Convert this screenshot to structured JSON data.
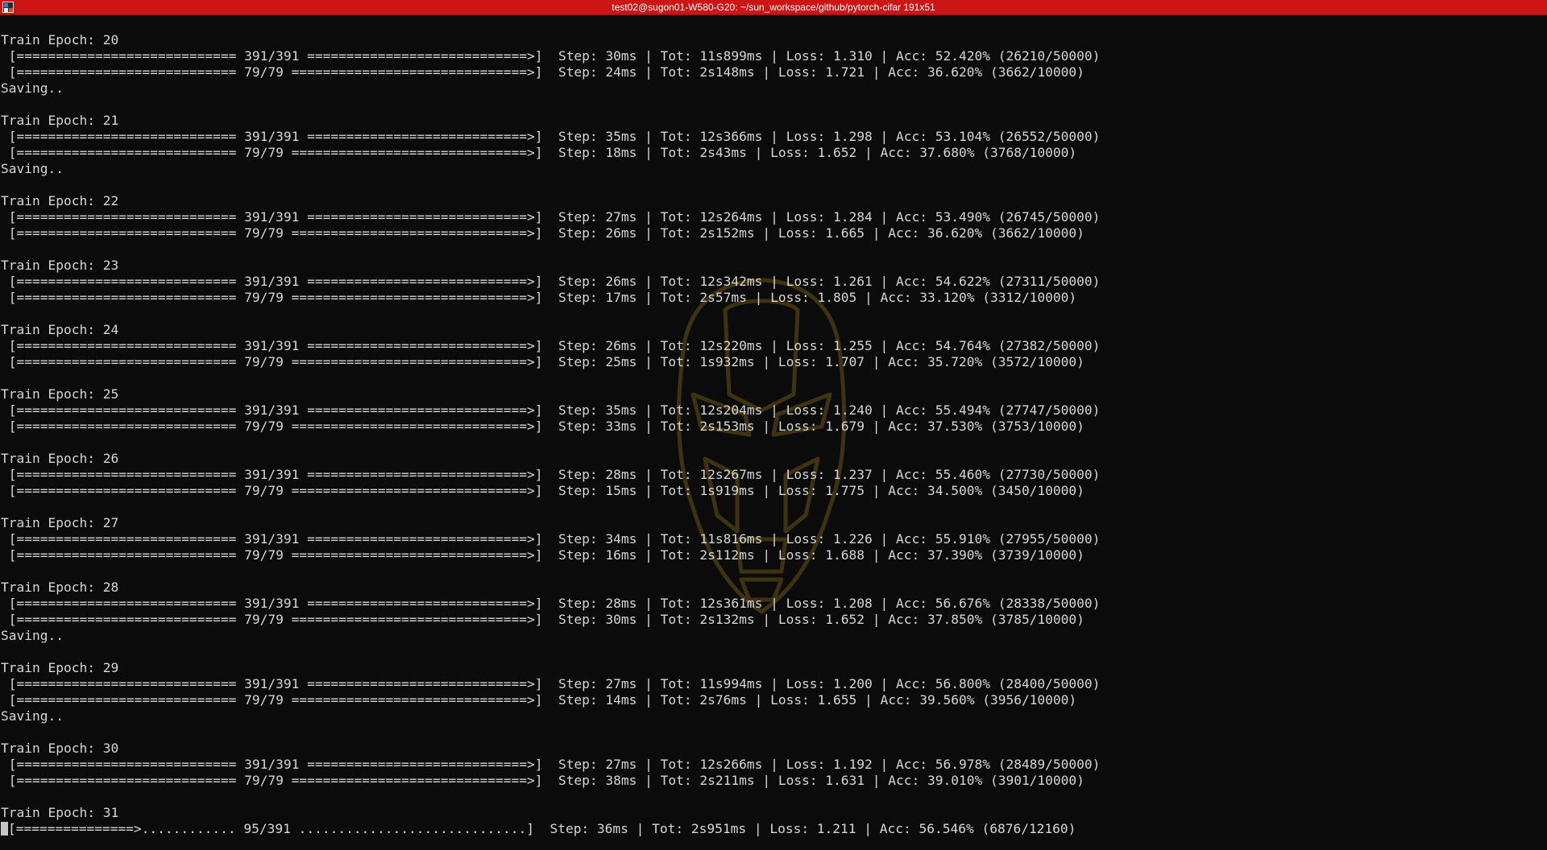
{
  "window": {
    "title": "test02@sugon01-W580-G20: ~/sun_workspace/github/pytorch-cifar 191x51"
  },
  "icons": {
    "app": "terminal-app-icon",
    "watermark": "iron-man-helmet-watermark-icon",
    "cursor": "block-cursor"
  },
  "colors": {
    "titlebar": "#cc1515",
    "background": "#0b0b0b",
    "text": "#d6d6d6",
    "watermark": "#6b5414"
  },
  "terminal": {
    "lines": [
      "Train Epoch: 20",
      " [============================ 391/391 ============================>]  Step: 30ms | Tot: 11s899ms | Loss: 1.310 | Acc: 52.420% (26210/50000)",
      " [============================ 79/79 ==============================>]  Step: 24ms | Tot: 2s148ms | Loss: 1.721 | Acc: 36.620% (3662/10000)",
      "Saving..",
      "",
      "Train Epoch: 21",
      " [============================ 391/391 ============================>]  Step: 35ms | Tot: 12s366ms | Loss: 1.298 | Acc: 53.104% (26552/50000)",
      " [============================ 79/79 ==============================>]  Step: 18ms | Tot: 2s43ms | Loss: 1.652 | Acc: 37.680% (3768/10000)",
      "Saving..",
      "",
      "Train Epoch: 22",
      " [============================ 391/391 ============================>]  Step: 27ms | Tot: 12s264ms | Loss: 1.284 | Acc: 53.490% (26745/50000)",
      " [============================ 79/79 ==============================>]  Step: 26ms | Tot: 2s152ms | Loss: 1.665 | Acc: 36.620% (3662/10000)",
      "",
      "Train Epoch: 23",
      " [============================ 391/391 ============================>]  Step: 26ms | Tot: 12s342ms | Loss: 1.261 | Acc: 54.622% (27311/50000)",
      " [============================ 79/79 ==============================>]  Step: 17ms | Tot: 2s57ms | Loss: 1.805 | Acc: 33.120% (3312/10000)",
      "",
      "Train Epoch: 24",
      " [============================ 391/391 ============================>]  Step: 26ms | Tot: 12s220ms | Loss: 1.255 | Acc: 54.764% (27382/50000)",
      " [============================ 79/79 ==============================>]  Step: 25ms | Tot: 1s932ms | Loss: 1.707 | Acc: 35.720% (3572/10000)",
      "",
      "Train Epoch: 25",
      " [============================ 391/391 ============================>]  Step: 35ms | Tot: 12s204ms | Loss: 1.240 | Acc: 55.494% (27747/50000)",
      " [============================ 79/79 ==============================>]  Step: 33ms | Tot: 2s153ms | Loss: 1.679 | Acc: 37.530% (3753/10000)",
      "",
      "Train Epoch: 26",
      " [============================ 391/391 ============================>]  Step: 28ms | Tot: 12s267ms | Loss: 1.237 | Acc: 55.460% (27730/50000)",
      " [============================ 79/79 ==============================>]  Step: 15ms | Tot: 1s919ms | Loss: 1.775 | Acc: 34.500% (3450/10000)",
      "",
      "Train Epoch: 27",
      " [============================ 391/391 ============================>]  Step: 34ms | Tot: 11s816ms | Loss: 1.226 | Acc: 55.910% (27955/50000)",
      " [============================ 79/79 ==============================>]  Step: 16ms | Tot: 2s112ms | Loss: 1.688 | Acc: 37.390% (3739/10000)",
      "",
      "Train Epoch: 28",
      " [============================ 391/391 ============================>]  Step: 28ms | Tot: 12s361ms | Loss: 1.208 | Acc: 56.676% (28338/50000)",
      " [============================ 79/79 ==============================>]  Step: 30ms | Tot: 2s132ms | Loss: 1.652 | Acc: 37.850% (3785/10000)",
      "Saving..",
      "",
      "Train Epoch: 29",
      " [============================ 391/391 ============================>]  Step: 27ms | Tot: 11s994ms | Loss: 1.200 | Acc: 56.800% (28400/50000)",
      " [============================ 79/79 ==============================>]  Step: 14ms | Tot: 2s76ms | Loss: 1.655 | Acc: 39.560% (3956/10000)",
      "Saving..",
      "",
      "Train Epoch: 30",
      " [============================ 391/391 ============================>]  Step: 27ms | Tot: 12s266ms | Loss: 1.192 | Acc: 56.978% (28489/50000)",
      " [============================ 79/79 ==============================>]  Step: 38ms | Tot: 2s211ms | Loss: 1.631 | Acc: 39.010% (3901/10000)",
      "",
      "Train Epoch: 31"
    ],
    "progress_line": "[===============>............ 95/391 .............................]  Step: 36ms | Tot: 2s951ms | Loss: 1.211 | Acc: 56.546% (6876/12160)"
  }
}
